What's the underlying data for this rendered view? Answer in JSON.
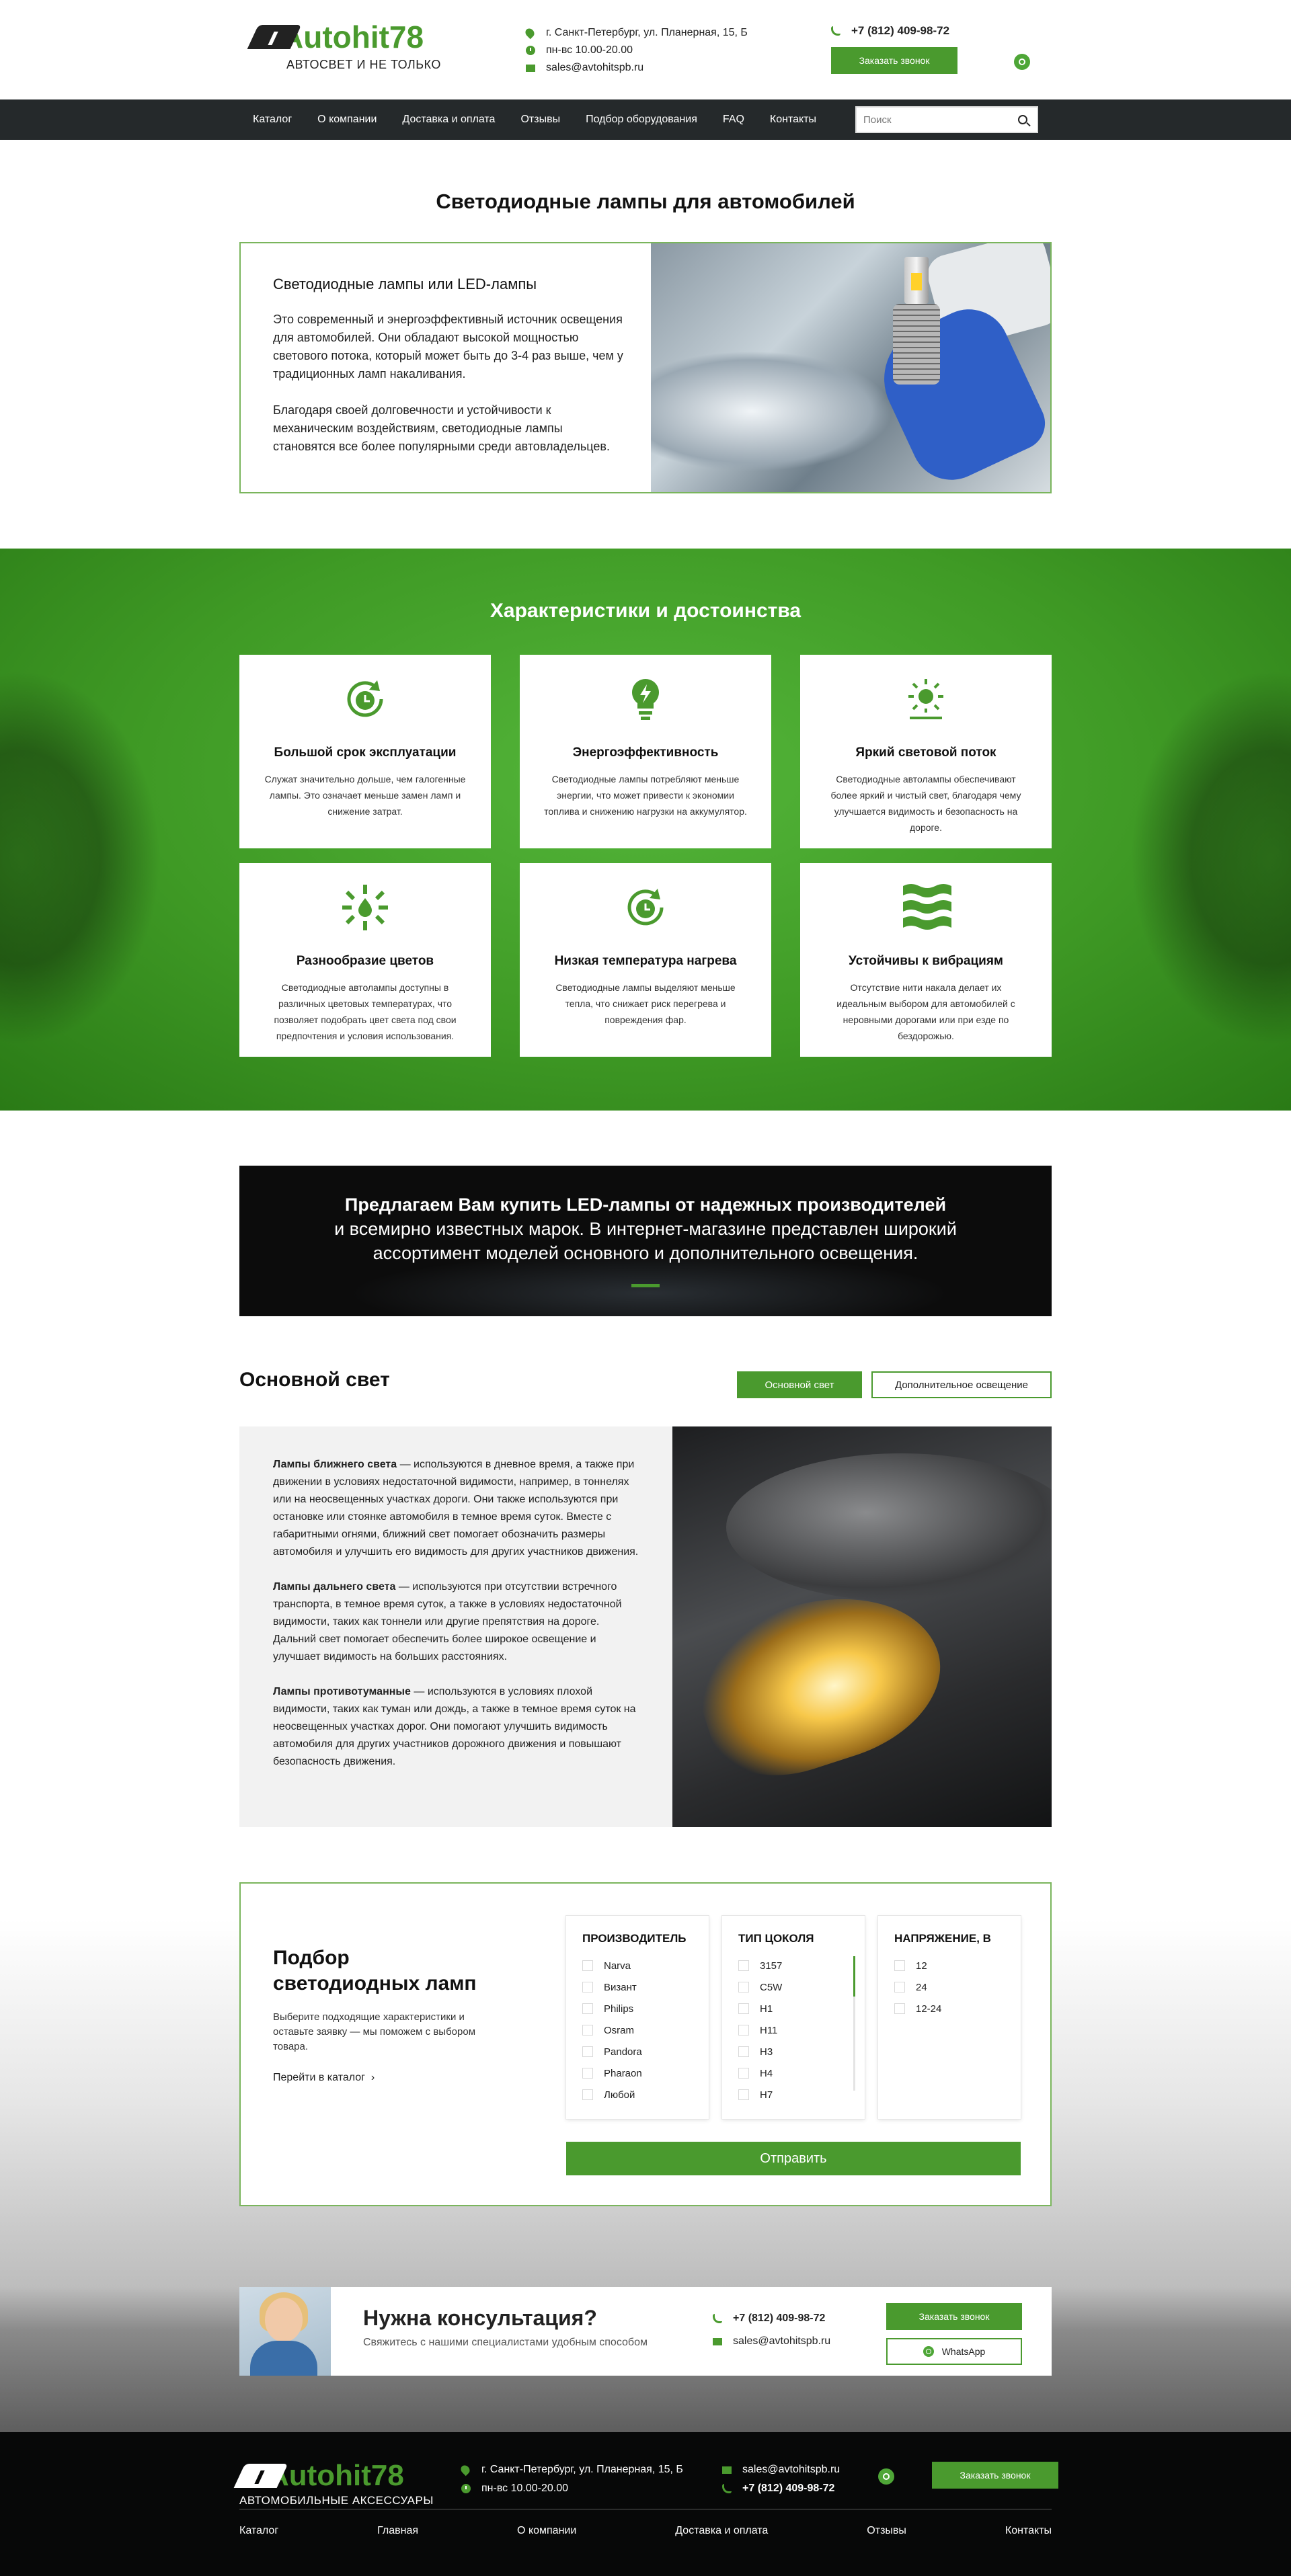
{
  "header": {
    "logo": "Autohit78",
    "logo_sub": "АВТОСВЕТ И НЕ ТОЛЬКО",
    "address": "г. Санкт-Петербург, ул. Планерная, 15, Б",
    "hours": "пн-вс 10.00-20.00",
    "email": "sales@avtohitspb.ru",
    "phone": "+7 (812) 409-98-72",
    "call_button": "Заказать звонок",
    "whatsapp_icon": "whatsapp-icon"
  },
  "nav": {
    "items": [
      "Каталог",
      "О компании",
      "Доставка и оплата",
      "Отзывы",
      "Подбор оборудования",
      "FAQ",
      "Контакты"
    ],
    "search_placeholder": "Поиск"
  },
  "intro": {
    "title": "Светодиодные лампы для автомобилей",
    "card_title": "Светодиодные лампы или LED-лампы",
    "p1": "Это современный и энергоэффективный источник освещения для автомобилей.  Они обладают высокой мощностью светового потока, который может быть до 3-4 раз выше, чем у традиционных ламп накаливания.",
    "p2": "Благодаря своей долговечности и устойчивости к механическим воздействиям, светодиодные лампы становятся все более популярными среди автовладельцев."
  },
  "features": {
    "title": "Характеристики и достоинства",
    "items": [
      {
        "icon": "clock-refresh-icon",
        "title": "Большой срок эксплуатации",
        "text": "Служат значительно дольше, чем галогенные лампы. Это означает меньше замен ламп и снижение затрат."
      },
      {
        "icon": "bulb-bolt-icon",
        "title": "Энергоэффективность",
        "text": "Светодиодные лампы потребляют меньше энергии, что может привести к экономии топлива и снижению нагрузки на аккумулятор."
      },
      {
        "icon": "sun-bright-icon",
        "title": "Яркий световой поток",
        "text": "Светодиодные автолампы обеспечивают более яркий и чистый свет, благодаря чему улучшается видимость и безопасность на дороге."
      },
      {
        "icon": "color-drop-icon",
        "title": "Разнообразие цветов",
        "text": "Светодиодные автолампы доступны в различных цветовых температурах, что позволяет подобрать цвет света под свои предпочтения и условия использования."
      },
      {
        "icon": "thermometer-icon",
        "title": "Низкая температура нагрева",
        "text": "Светодиодные лампы выделяют меньше тепла, что снижает риск перегрева и повреждения фар."
      },
      {
        "icon": "vibration-waves-icon",
        "title": "Устойчивы к вибрациям",
        "text": "Отсутствие нити накала делает их идеальным выбором для автомобилей с неровными дорогами или при езде по бездорожью."
      }
    ]
  },
  "cta": {
    "line1": "Предлагаем Вам купить LED-лампы от надежных производителей",
    "line2": "и всемирно известных марок. В интернет-магазине представлен широкий",
    "line3": "ассортимент моделей основного и дополнительного освещения."
  },
  "main_light": {
    "title": "Основной свет",
    "tab1": "Основной свет",
    "tab2": "Дополнительное освещение",
    "p1_bold": "Лампы ближнего света",
    "p1": " — используются в дневное время, а также при движении в условиях недостаточной видимости, например, в тоннелях или на неосвещенных участках дороги. Они также используются при остановке или стоянке автомобиля в темное время суток. Вместе с габаритными огнями, ближний свет помогает обозначить размеры автомобиля и улучшить его видимость для других участников движения.",
    "p2_bold": "Лампы дальнего света",
    "p2": " — используются при отсутствии встречного транспорта, в темное время суток, а также в условиях недостаточной видимости, таких как тоннели или другие препятствия на дороге. Дальний свет помогает обеспечить более широкое освещение и улучшает видимость на больших расстояниях.",
    "p3_bold": "Лампы противотуманные",
    "p3": " — используются в условиях плохой видимости, таких как туман или дождь, а также в темное время суток на неосвещенных участках дорог. Они помогают улучшить видимость автомобиля для других участников дорожного движения и повышают безопасность движения."
  },
  "selector": {
    "title": "Подбор светодиодных ламп",
    "text": "Выберите подходящие характеристики и оставьте заявку — мы поможем с выбором товара.",
    "link": "Перейти в каталог",
    "columns": [
      {
        "title": "ПРОИЗВОДИТЕЛЬ",
        "options": [
          "Narva",
          "Визант",
          "Philips",
          "Osram",
          "Pandora",
          "Pharaon",
          "Любой"
        ]
      },
      {
        "title": "ТИП ЦОКОЛЯ",
        "options": [
          "3157",
          "C5W",
          "H1",
          "H11",
          "H3",
          "H4",
          "H7"
        ]
      },
      {
        "title": "НАПРЯЖЕНИЕ, В",
        "options": [
          "12",
          "24",
          "12-24"
        ]
      }
    ],
    "submit": "Отправить"
  },
  "consult": {
    "title": "Нужна консультация?",
    "sub": "Свяжитесь с нашими специалистами удобным способом",
    "phone": "+7 (812) 409-98-72",
    "email": "sales@avtohitspb.ru",
    "call_button": "Заказать звонок",
    "wa_button": "WhatsApp"
  },
  "footer": {
    "logo": "Autohit78",
    "logo_sub": "АВТОМОБИЛЬНЫЕ АКСЕССУАРЫ",
    "address": "г. Санкт-Петербург, ул. Планерная, 15, Б",
    "hours": "пн-вс 10.00-20.00",
    "email": "sales@avtohitspb.ru",
    "phone": "+7 (812) 409-98-72",
    "call_button": "Заказать звонок",
    "nav": [
      "Каталог",
      "Главная",
      "О компании",
      "Доставка и оплата",
      "Отзывы",
      "Контакты"
    ]
  },
  "colors": {
    "accent": "#4a9a2e",
    "nav_bg": "#25292b",
    "footer_bg": "#070808"
  }
}
